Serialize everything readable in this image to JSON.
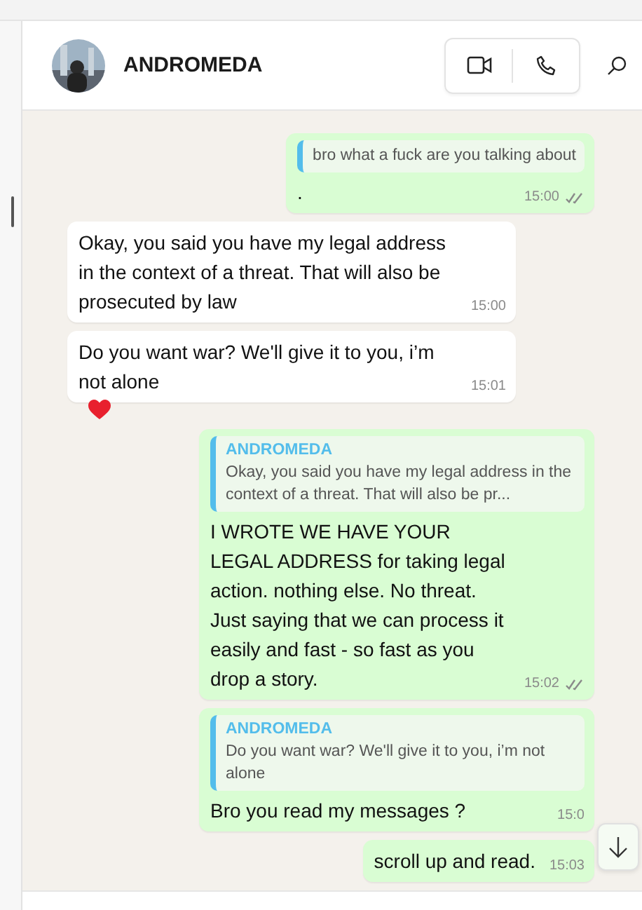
{
  "header": {
    "contact_name": "ANDROMEDA"
  },
  "messages": [
    {
      "kind": "outgoing",
      "quote": {
        "text": "bro what a fuck are you talking about"
      },
      "text": ".",
      "time": "15:00",
      "read": true
    },
    {
      "kind": "incoming",
      "text": "Okay, you said you have my legal address in the context of a threat. That will also be prosecuted by law",
      "time": "15:00"
    },
    {
      "kind": "incoming",
      "text": "Do you want war? We'll give it to you, i’m not alone",
      "time": "15:01",
      "reacted": true
    },
    {
      "kind": "outgoing",
      "quote": {
        "author": "ANDROMEDA",
        "text": "Okay, you said you have my legal address in the context of a threat. That will also be pr..."
      },
      "text": "I WROTE WE HAVE YOUR LEGAL ADDRESS for taking legal action. nothing else. No threat. Just saying that we can process it easily and fast - so fast as you drop a story.",
      "time": "15:02",
      "read": true
    },
    {
      "kind": "outgoing",
      "quote": {
        "author": "ANDROMEDA",
        "text": "Do you want war? We'll give it to you, i’m not alone"
      },
      "text": "Bro you read my messages ?",
      "time": "15:0",
      "read": false
    },
    {
      "kind": "outgoing",
      "text": "scroll up and read.",
      "time": "15:03",
      "read": false
    }
  ]
}
